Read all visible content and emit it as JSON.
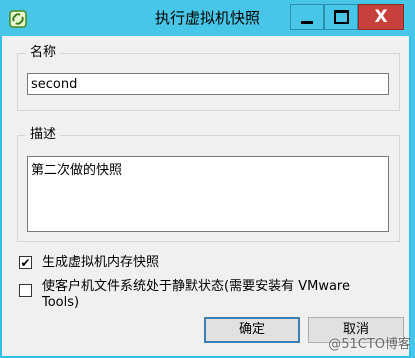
{
  "window": {
    "title": "执行虚拟机快照",
    "close_glyph": "X",
    "controls": [
      "minimize-icon",
      "maximize-icon",
      "close-icon"
    ]
  },
  "name_group": {
    "legend": "名称",
    "value": "second"
  },
  "desc_group": {
    "legend": "描述",
    "value": "第二次做的快照"
  },
  "options": [
    {
      "label": "生成虚拟机内存快照",
      "checked": true,
      "check_glyph": "✔"
    },
    {
      "label_line1": "使客户机文件系统处于静默状态(需要安装有 VMware",
      "label_line2": "Tools)",
      "checked": false
    }
  ],
  "buttons": {
    "ok": "确定",
    "cancel": "取消"
  },
  "watermark": "@51CTO博客"
}
